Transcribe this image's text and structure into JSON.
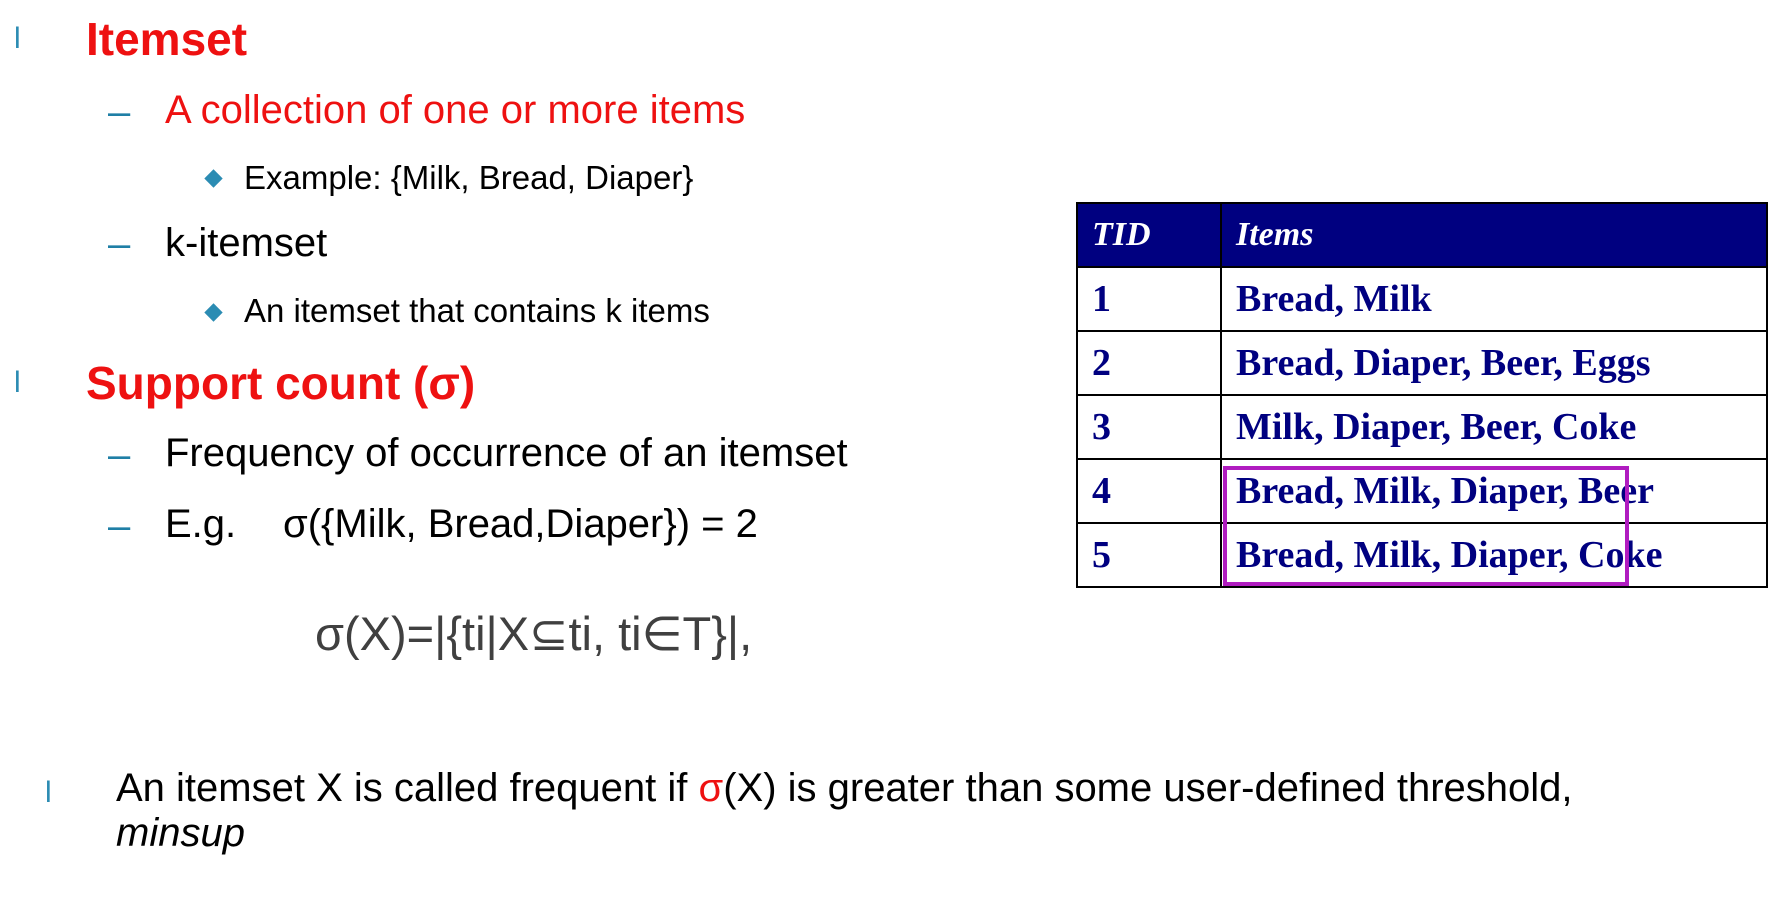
{
  "left_column": {
    "bullet_glyph": "l",
    "itemset": {
      "heading": "Itemset",
      "sub1": "A collection of one or more items",
      "sub1_example": "Example: {Milk, Bread, Diaper}",
      "sub2": "k-itemset",
      "sub2_detail": "An itemset that contains k items"
    },
    "support": {
      "heading": "Support count (σ)",
      "sub1": "Frequency of occurrence of an itemset",
      "sub2_prefix": "E.g.",
      "sub2_expr": "σ({Milk, Bread,Diaper}) = 2"
    },
    "dash_glyph": "–",
    "formula": "σ(X)=|{ti|X⊆ti, ti∈T}|,"
  },
  "transactions": {
    "headers": [
      "TID",
      "Items"
    ],
    "rows": [
      {
        "tid": "1",
        "items": "Bread, Milk"
      },
      {
        "tid": "2",
        "items": "Bread, Diaper, Beer, Eggs"
      },
      {
        "tid": "3",
        "items": "Milk, Diaper, Beer, Coke"
      },
      {
        "tid": "4",
        "items": "Bread, Milk, Diaper, Beer"
      },
      {
        "tid": "5",
        "items": "Bread, Milk, Diaper, Coke"
      }
    ],
    "header_bg": "#000080",
    "text_color": "#000080",
    "highlight_color": "#b01cc0",
    "highlighted_itemset_rows": [
      "4",
      "5"
    ]
  },
  "note": {
    "text_before": "An itemset X is called frequent if ",
    "sigma": "σ",
    "text_after": "(X) is greater than some user-defined threshold,",
    "minsup": "minsup"
  }
}
